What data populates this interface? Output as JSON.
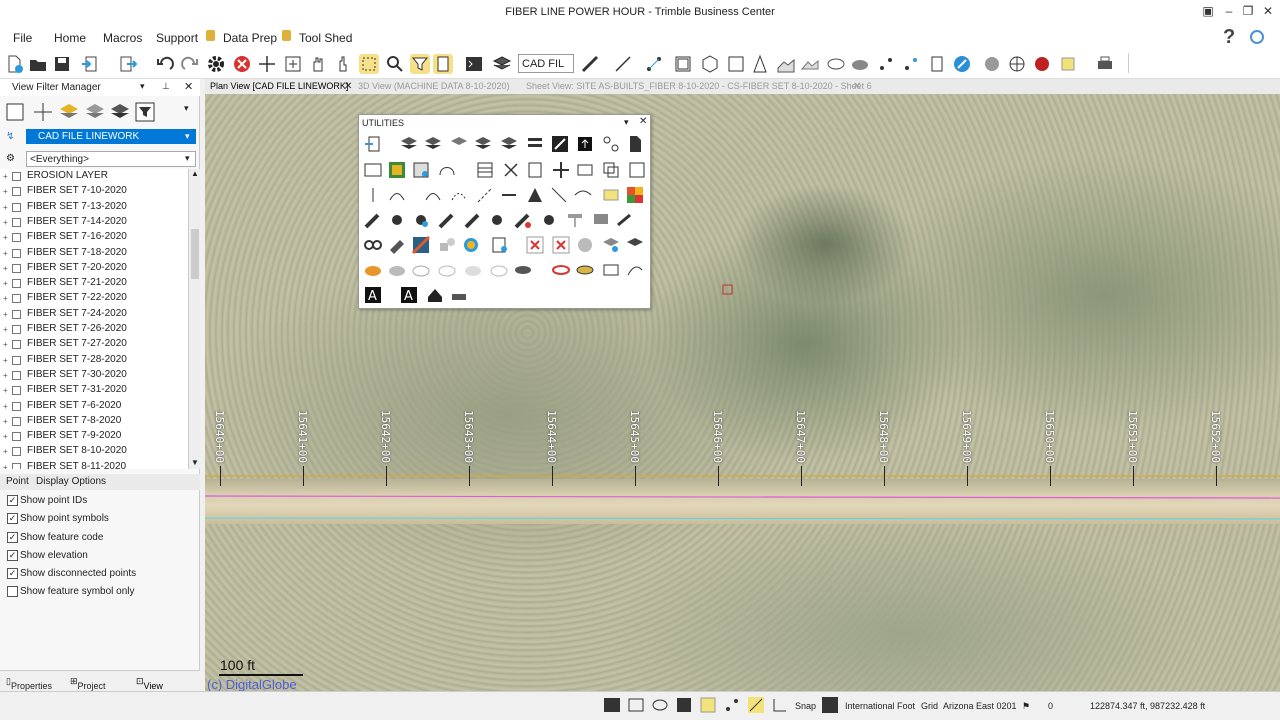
{
  "window": {
    "title": "FIBER LINE POWER HOUR - Trimble Business Center",
    "controls": [
      "▣",
      "–",
      "❐",
      "✕"
    ]
  },
  "menu": {
    "items": [
      {
        "label": "File",
        "locked": false
      },
      {
        "label": "Home",
        "locked": false
      },
      {
        "label": "Macros",
        "locked": false
      },
      {
        "label": "Support",
        "locked": false
      },
      {
        "label": "Data Prep",
        "locked": true
      },
      {
        "label": "Tool Shed",
        "locked": true
      }
    ],
    "help_glyph": "?"
  },
  "toolbar": {
    "cad_filter_value": "CAD FIL"
  },
  "view_filter": {
    "title": "View Filter Manager",
    "filter_selected": "CAD FILE LINEWORK",
    "everything_select": "<Everything>",
    "layers": [
      "EROSION LAYER",
      "FIBER SET 7-10-2020",
      "FIBER SET 7-13-2020",
      "FIBER SET 7-14-2020",
      "FIBER SET 7-16-2020",
      "FIBER SET 7-18-2020",
      "FIBER SET 7-20-2020",
      "FIBER SET 7-21-2020",
      "FIBER SET 7-22-2020",
      "FIBER SET 7-24-2020",
      "FIBER SET 7-26-2020",
      "FIBER SET 7-27-2020",
      "FIBER SET 7-28-2020",
      "FIBER SET 7-30-2020",
      "FIBER SET 7-31-2020",
      "FIBER SET 7-6-2020",
      "FIBER SET 7-8-2020",
      "FIBER SET 7-9-2020",
      "FIBER SET 8-10-2020",
      "FIBER SET 8-11-2020"
    ],
    "option_tabs": [
      "Point",
      "Display Options"
    ],
    "options": [
      {
        "label": "Show point IDs",
        "checked": true
      },
      {
        "label": "Show point symbols",
        "checked": true
      },
      {
        "label": "Show feature code",
        "checked": true
      },
      {
        "label": "Show elevation",
        "checked": true
      },
      {
        "label": "Show disconnected points",
        "checked": true
      },
      {
        "label": "Show feature symbol only",
        "checked": false
      }
    ],
    "bottom_tabs": [
      "Properties",
      "Project Expl...",
      "View Filter..."
    ]
  },
  "doc_tabs": [
    {
      "label": "Plan View [CAD FILE LINEWORK]",
      "active": true
    },
    {
      "label": "3D View (MACHINE DATA 8-10-2020)",
      "active": false
    },
    {
      "label": "Sheet View: SITE AS-BUILTS_FIBER 8-10-2020 - CS-FIBER SET 8-10-2020 - Sheet 6",
      "active": false
    }
  ],
  "plan_view": {
    "stations": [
      "15640+00",
      "15641+00",
      "15642+00",
      "15643+00",
      "15644+00",
      "15645+00",
      "15646+00",
      "15647+00",
      "15648+00",
      "15649+00",
      "15650+00",
      "15651+00",
      "15652+00"
    ],
    "scale_label": "100 ft",
    "copyright": "(c) DigitalGlobe",
    "line_colors": {
      "alignment": "#d4a93a",
      "magenta": "#e05adf",
      "cyan": "#54d8e0"
    }
  },
  "utilities": {
    "title": "UTILITIES"
  },
  "status": {
    "snap": "Snap",
    "units": "International Foot",
    "grid": "Grid",
    "zone": "Arizona East 0201",
    "elevation_value": "0",
    "coordinates": "122874.347 ft, 987232.428 ft"
  }
}
